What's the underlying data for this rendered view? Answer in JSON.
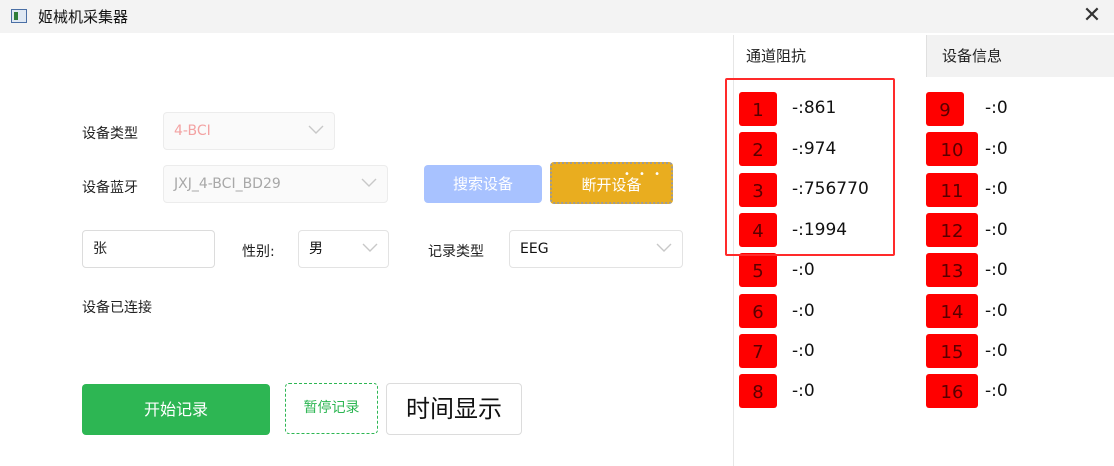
{
  "window": {
    "title": "姬械机采集器",
    "close_glyph": "✕"
  },
  "form": {
    "device_type_label": "设备类型",
    "device_type_value": "4-BCI",
    "device_bt_label": "设备蓝牙",
    "device_bt_value": "JXJ_4-BCI_BD29",
    "search_button": "搜索设备",
    "disconnect_button": "断开设备",
    "disconnect_sparkles": "• • •",
    "name_value": "张",
    "gender_label": "性别:",
    "gender_value": "男",
    "record_type_label": "记录类型",
    "record_type_value": "EEG",
    "status_text": "设备已连接",
    "start_button": "开始记录",
    "pause_button": "暂停记录",
    "time_button": "时间显示"
  },
  "colors": {
    "accent_green": "#2db653",
    "accent_orange": "#e9ad1f",
    "search_blue": "#a8c2ff",
    "channel_red": "#ff0000",
    "highlight_red": "#ff2a2a",
    "disabled_text": "#f3a3a3"
  },
  "tabs": [
    {
      "label": "通道阻抗",
      "active": true
    },
    {
      "label": "设备信息",
      "active": false
    }
  ],
  "channels": [
    {
      "num": "1",
      "value": "-:861"
    },
    {
      "num": "2",
      "value": "-:974"
    },
    {
      "num": "3",
      "value": "-:756770"
    },
    {
      "num": "4",
      "value": "-:1994"
    },
    {
      "num": "5",
      "value": "-:0"
    },
    {
      "num": "6",
      "value": "-:0"
    },
    {
      "num": "7",
      "value": "-:0"
    },
    {
      "num": "8",
      "value": "-:0"
    },
    {
      "num": "9",
      "value": "-:0"
    },
    {
      "num": "10",
      "value": "-:0"
    },
    {
      "num": "11",
      "value": "-:0"
    },
    {
      "num": "12",
      "value": "-:0"
    },
    {
      "num": "13",
      "value": "-:0"
    },
    {
      "num": "14",
      "value": "-:0"
    },
    {
      "num": "15",
      "value": "-:0"
    },
    {
      "num": "16",
      "value": "-:0"
    }
  ]
}
